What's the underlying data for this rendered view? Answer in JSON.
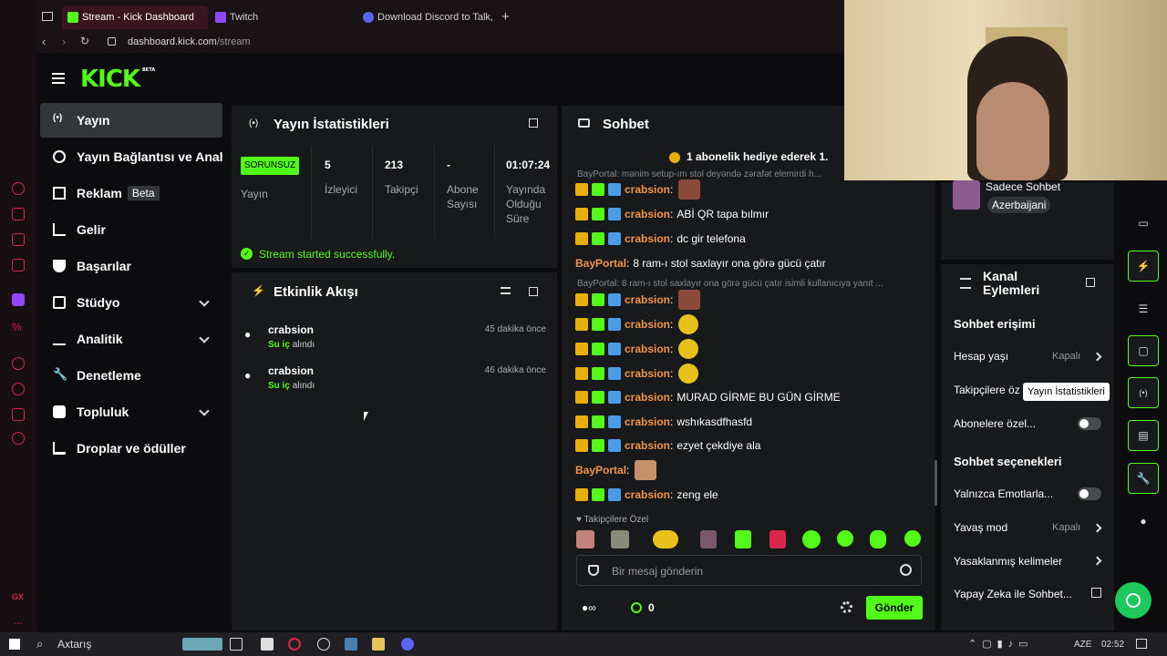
{
  "browser": {
    "tabs": [
      {
        "label": "Stream - Kick Dashboard"
      },
      {
        "label": "Twitch"
      },
      {
        "label": "Download Discord to Talk, C"
      }
    ],
    "url_domain": "dashboard.kick.com",
    "url_path": "/stream"
  },
  "logo": {
    "text": "KICK",
    "beta": "BETA"
  },
  "sidebar": {
    "items": [
      {
        "label": "Yayın"
      },
      {
        "label": "Yayın Bağlantısı ve Anahtarı"
      },
      {
        "label": "Reklam",
        "badge": "Beta"
      },
      {
        "label": "Gelir"
      },
      {
        "label": "Başarılar"
      },
      {
        "label": "Stüdyo"
      },
      {
        "label": "Analitik"
      },
      {
        "label": "Denetleme"
      },
      {
        "label": "Topluluk"
      },
      {
        "label": "Droplar ve ödüller"
      }
    ]
  },
  "stats": {
    "title": "Yayın İstatistikleri",
    "status": "SORUNSUZ",
    "status_label": "Yayın",
    "viewers": "5",
    "viewers_label": "İzleyici",
    "followers": "213",
    "followers_label": "Takipçi",
    "subs": "-",
    "subs_label": "Abone Sayısı",
    "uptime": "01:07:24",
    "uptime_label": "Yayında Olduğu Süre",
    "success_msg": "Stream started successfully."
  },
  "activity": {
    "title": "Etkinlik Akışı",
    "items": [
      {
        "user": "crabsion",
        "action_item": "Su iç",
        "action": "alındı",
        "time": "45 dakika önce"
      },
      {
        "user": "crabsion",
        "action_item": "Su iç",
        "action": "alındı",
        "time": "46 dakika önce"
      }
    ]
  },
  "chat": {
    "title": "Sohbet",
    "pinned": "1 abonelik hediye ederek 1.",
    "reply1": "BayPortal: mənim setup-ım stol deyəndə zərafət elemirdi h...",
    "reply2": "BayPortal: 8 ram-ı stol saxlayır ona görə gücü çatır isimli kullanıcıya yanıt ...",
    "messages": [
      {
        "user": "crabsion",
        "text": ""
      },
      {
        "user": "crabsion",
        "text": "ABİ QR tapa bılmır"
      },
      {
        "user": "crabsion",
        "text": "dc gir telefona"
      },
      {
        "user": "BayPortal",
        "text": "8 ram-ı stol saxlayır ona görə gücü çatır"
      },
      {
        "user": "crabsion",
        "text": ""
      },
      {
        "user": "crabsion",
        "text": ""
      },
      {
        "user": "crabsion",
        "text": ""
      },
      {
        "user": "crabsion",
        "text": ""
      },
      {
        "user": "crabsion",
        "text": "MURAD GİRME BU GÜN GİRME"
      },
      {
        "user": "crabsion",
        "text": "wshıkasdfhasfd"
      },
      {
        "user": "crabsion",
        "text": "ezyet çekdiye ala"
      },
      {
        "user": "BayPortal",
        "text": ""
      },
      {
        "user": "crabsion",
        "text": "zeng ele"
      }
    ],
    "followers_only": "Takipçilere Özel",
    "input_placeholder": "Bir mesaj gönderin",
    "points": "0",
    "send": "Gönder"
  },
  "right_panel": {
    "mode_title": "Sadece Sohbet",
    "mode_badge": "Azerbaijani",
    "actions_title": "Kanal Eylemleri",
    "access_title": "Sohbet erişimi",
    "account_age": "Hesap yaşı",
    "account_age_val": "Kapalı",
    "followers_only": "Takipçilere öz",
    "subs_only": "Abonelere özel...",
    "options_title": "Sohbet seçenekleri",
    "emotes_only": "Yalnızca Emotlarla...",
    "slow_mode": "Yavaş mod",
    "slow_mode_val": "Kapalı",
    "banned_words": "Yasaklanmış kelimeler",
    "ai": "Yapay Zeka ile Sohbet..."
  },
  "tooltip": "Yayın İstatistikleri",
  "taskbar": {
    "search": "Axtarış",
    "lang": "AZE",
    "time": "02:52"
  },
  "colors": {
    "accent": "#53fc18",
    "panel": "#18191b",
    "username": "#f29447"
  }
}
